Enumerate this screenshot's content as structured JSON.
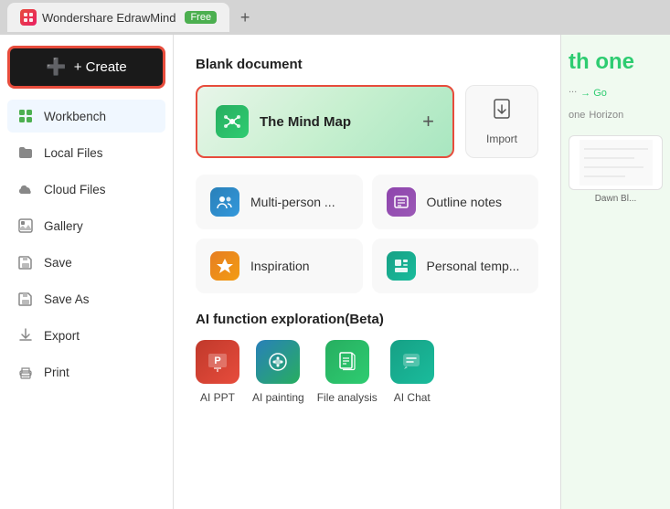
{
  "tabbar": {
    "app_name": "Wondershare EdrawMind",
    "badge": "Free",
    "new_tab_icon": "+"
  },
  "sidebar": {
    "create_label": "+ Create",
    "items": [
      {
        "id": "workbench",
        "label": "Workbench",
        "icon": "🏠"
      },
      {
        "id": "local-files",
        "label": "Local Files",
        "icon": "📁"
      },
      {
        "id": "cloud-files",
        "label": "Cloud Files",
        "icon": "☁"
      },
      {
        "id": "gallery",
        "label": "Gallery",
        "icon": "🖼"
      },
      {
        "id": "save",
        "label": "Save",
        "icon": "💾"
      },
      {
        "id": "save-as",
        "label": "Save As",
        "icon": "💾"
      },
      {
        "id": "export",
        "label": "Export",
        "icon": "📤"
      },
      {
        "id": "print",
        "label": "Print",
        "icon": "🖨"
      }
    ]
  },
  "main": {
    "blank_doc_title": "Blank document",
    "mind_map_label": "The Mind Map",
    "import_label": "Import",
    "features": [
      {
        "id": "multi-person",
        "label": "Multi-person ...",
        "icon_color": "blue"
      },
      {
        "id": "outline-notes",
        "label": "Outline notes",
        "icon_color": "purple"
      },
      {
        "id": "inspiration",
        "label": "Inspiration",
        "icon_color": "yellow"
      },
      {
        "id": "personal-temp",
        "label": "Personal temp...",
        "icon_color": "teal"
      }
    ],
    "ai_section_title": "AI function exploration(Beta)",
    "ai_items": [
      {
        "id": "ai-ppt",
        "label": "AI PPT",
        "icon_color": "red"
      },
      {
        "id": "ai-painting",
        "label": "AI painting",
        "icon_color": "blue-green"
      },
      {
        "id": "file-analysis",
        "label": "File analysis",
        "icon_color": "green"
      },
      {
        "id": "ai-chat",
        "label": "AI Chat",
        "icon_color": "teal"
      }
    ]
  },
  "right_panel": {
    "text": "th one",
    "go_label": "→ Go",
    "template_label": "Dawn Bl...",
    "horizon_label": "Horizon",
    "horizon_alt": "one"
  }
}
